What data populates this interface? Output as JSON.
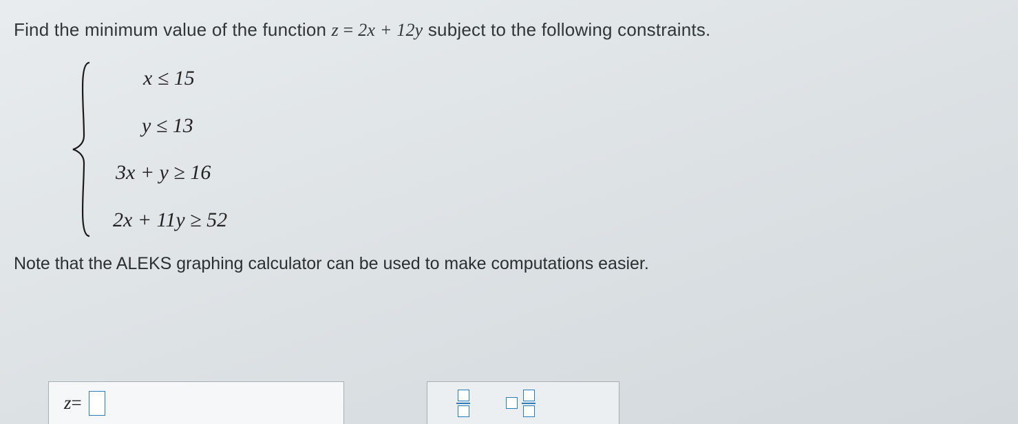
{
  "question": {
    "prompt_before": "Find the minimum value of the function ",
    "func_lhs": "z",
    "eq": " = ",
    "func_rhs": "2x + 12y",
    "prompt_after": " subject to the following constraints."
  },
  "constraints": {
    "c1": "x ≤ 15",
    "c2": "y ≤ 13",
    "c3": "3x + y ≥ 16",
    "c4": "2x + 11y ≥ 52"
  },
  "note": "Note that the ALEKS graphing calculator can be used to make computations easier.",
  "answer": {
    "label": "z",
    "equals": " = ",
    "value": ""
  },
  "tools": {
    "fraction": "fraction-tool",
    "mixed_number": "mixed-number-tool"
  }
}
